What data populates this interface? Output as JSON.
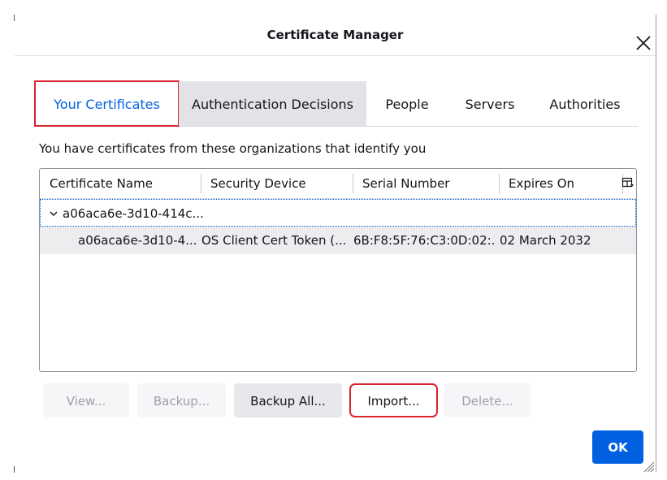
{
  "dialog": {
    "title": "Certificate Manager"
  },
  "tabs": [
    {
      "label": "Your Certificates",
      "selected": true
    },
    {
      "label": "Authentication Decisions",
      "selected": false
    },
    {
      "label": "People",
      "selected": false
    },
    {
      "label": "Servers",
      "selected": false
    },
    {
      "label": "Authorities",
      "selected": false
    }
  ],
  "description": "You have certificates from these organizations that identify you",
  "table": {
    "columns": [
      "Certificate Name",
      "Security Device",
      "Serial Number",
      "Expires On"
    ],
    "group_label": "a06aca6e-3d10-414c...",
    "rows": [
      {
        "name": "a06aca6e-3d10-4...",
        "device": "OS Client Cert Token (...",
        "serial": "6B:F8:5F:76:C3:0D:02:...",
        "expires": "02 March 2032"
      }
    ]
  },
  "buttons": {
    "view": "View...",
    "backup": "Backup...",
    "backup_all": "Backup All...",
    "import": "Import...",
    "delete": "Delete...",
    "ok": "OK"
  },
  "icons": {
    "close": "close-icon",
    "column_picker": "column-picker-icon",
    "expand": "chevron-down-icon",
    "resize": "resize-grip-icon"
  },
  "colors": {
    "accent": "#0061e0",
    "highlight": "#d9232e"
  }
}
